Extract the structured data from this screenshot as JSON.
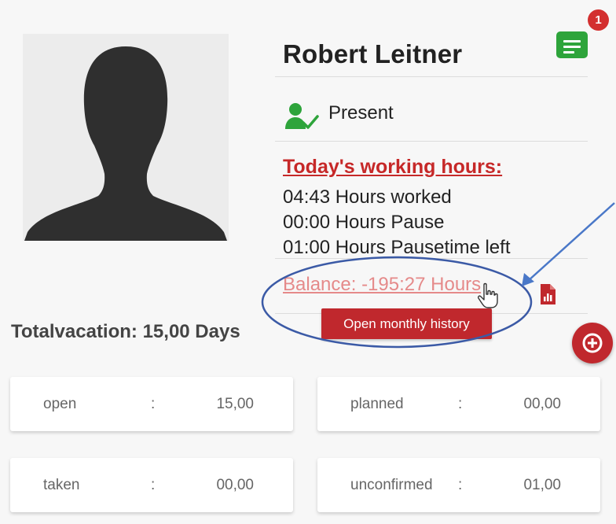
{
  "employee": {
    "name": "Robert Leitner",
    "status": "Present"
  },
  "notifications": {
    "count": "1"
  },
  "working_hours": {
    "title": "Today's working hours:",
    "lines": [
      "04:43 Hours worked",
      "00:00 Hours Pause",
      "01:00 Hours Pausetime left"
    ]
  },
  "balance": {
    "text": "Balance: -195:27 Hours",
    "button_label": "Open monthly history"
  },
  "vacation": {
    "title": "Totalvacation: 15,00 Days",
    "separator": ":",
    "cards": [
      {
        "label": "open",
        "value": "15,00"
      },
      {
        "label": "planned",
        "value": "00,00"
      },
      {
        "label": "taken",
        "value": "00,00"
      },
      {
        "label": "unconfirmed",
        "value": "01,00"
      }
    ]
  },
  "colors": {
    "accent_red": "#c0282d",
    "present_green": "#2ea43b",
    "annotation_blue": "#3b5aa6"
  }
}
